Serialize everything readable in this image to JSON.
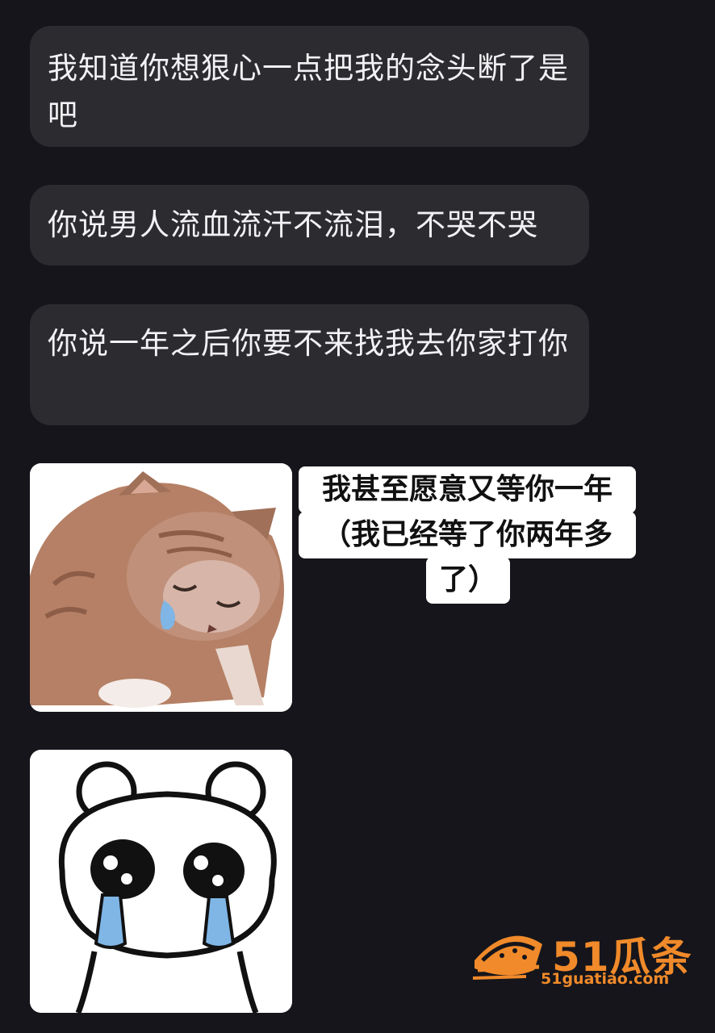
{
  "messages": [
    {
      "text": "我知道你想狠心一点把我的念头断了是吧"
    },
    {
      "text": "你说男人流血流汗不流泪，不哭不哭"
    },
    {
      "text": "你说一年之后你要不来找我去你家打你"
    }
  ],
  "sticker_cat": {
    "caption_line1": "我甚至愿意又等你一年",
    "caption_line2": "（我已经等了你两年多",
    "caption_line3": "了）"
  },
  "sticker_bear": {},
  "watermark": {
    "brand": "51瓜条",
    "url": "51guatiao.com"
  },
  "colors": {
    "background": "#15151b",
    "bubble": "#2b2b30",
    "bubble_text": "#f2f2f4",
    "watermark": "#f08a2a",
    "tear": "#7fb6e6"
  }
}
